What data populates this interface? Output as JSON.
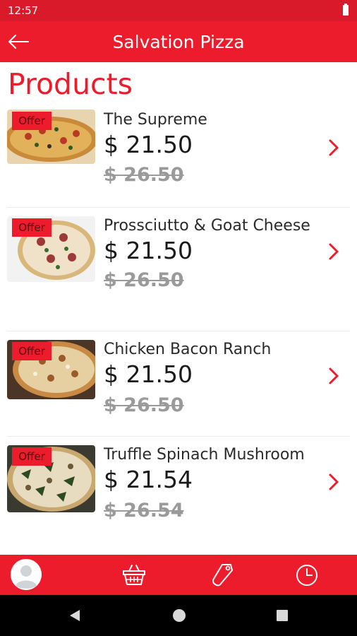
{
  "status": {
    "time": "12:57"
  },
  "app_bar": {
    "title": "Salvation Pizza",
    "back_icon": "arrow-left-icon"
  },
  "page": {
    "title": "Products"
  },
  "products": [
    {
      "name": "The Supreme",
      "price": "$ 21.50",
      "old_price": "$ 26.50",
      "badge": "Offer"
    },
    {
      "name": "Prossciutto & Goat Cheese",
      "price": "$ 21.50",
      "old_price": "$ 26.50",
      "badge": "Offer"
    },
    {
      "name": "Chicken Bacon Ranch",
      "price": "$ 21.50",
      "old_price": "$ 26.50",
      "badge": "Offer"
    },
    {
      "name": "Truffle Spinach Mushroom",
      "price": "$ 21.54",
      "old_price": "$ 26.54",
      "badge": "Offer"
    }
  ],
  "bottom_nav": [
    "profile-avatar-icon",
    "basket-icon",
    "tag-icon",
    "clock-icon"
  ],
  "system_nav": [
    "back-triangle-icon",
    "home-circle-icon",
    "recents-square-icon"
  ],
  "colors": {
    "accent": "#ec1c2c",
    "status_bar": "#d91a2a",
    "old_price": "#9a9a9a"
  }
}
